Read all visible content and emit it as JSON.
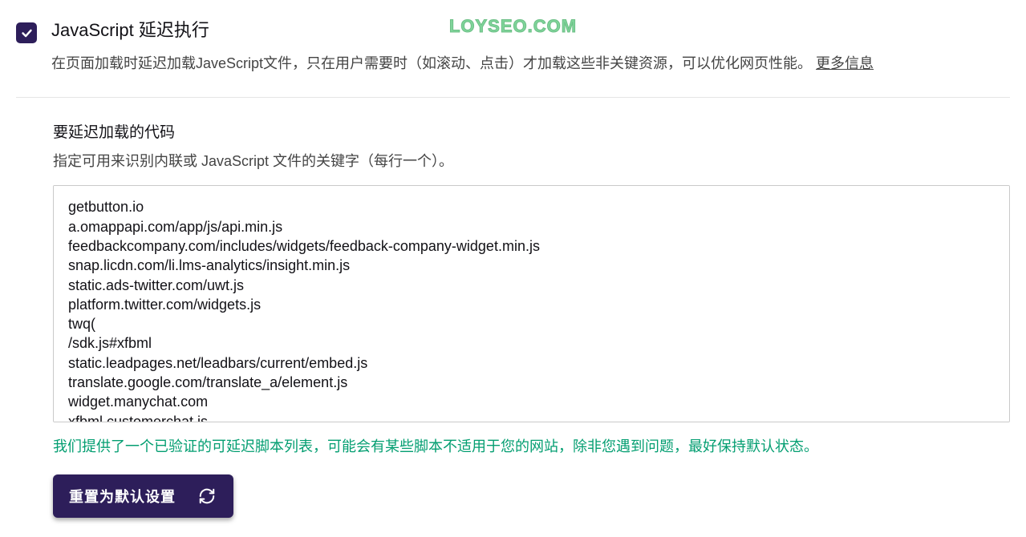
{
  "watermark": "LOYSEO.COM",
  "header": {
    "title": "JavaScript 延迟执行",
    "description": "在页面加载时延迟加载JaveScript文件，只在用户需要时（如滚动、点击）才加载这些非关键资源，可以优化网页性能。",
    "more_link": "更多信息"
  },
  "section": {
    "title": "要延迟加载的代码",
    "subtitle": "指定可用来识别内联或 JavaScript 文件的关键字（每行一个）。",
    "textarea_value": "getbutton.io\na.omappapi.com/app/js/api.min.js\nfeedbackcompany.com/includes/widgets/feedback-company-widget.min.js\nsnap.licdn.com/li.lms-analytics/insight.min.js\nstatic.ads-twitter.com/uwt.js\nplatform.twitter.com/widgets.js\ntwq(\n/sdk.js#xfbml\nstatic.leadpages.net/leadbars/current/embed.js\ntranslate.google.com/translate_a/element.js\nwidget.manychat.com\nxfbml.customerchat.js",
    "notice": "我们提供了一个已验证的可延迟脚本列表，可能会有某些脚本不适用于您的网站，除非您遇到问题，最好保持默认状态。",
    "reset_label": "重置为默认设置"
  }
}
